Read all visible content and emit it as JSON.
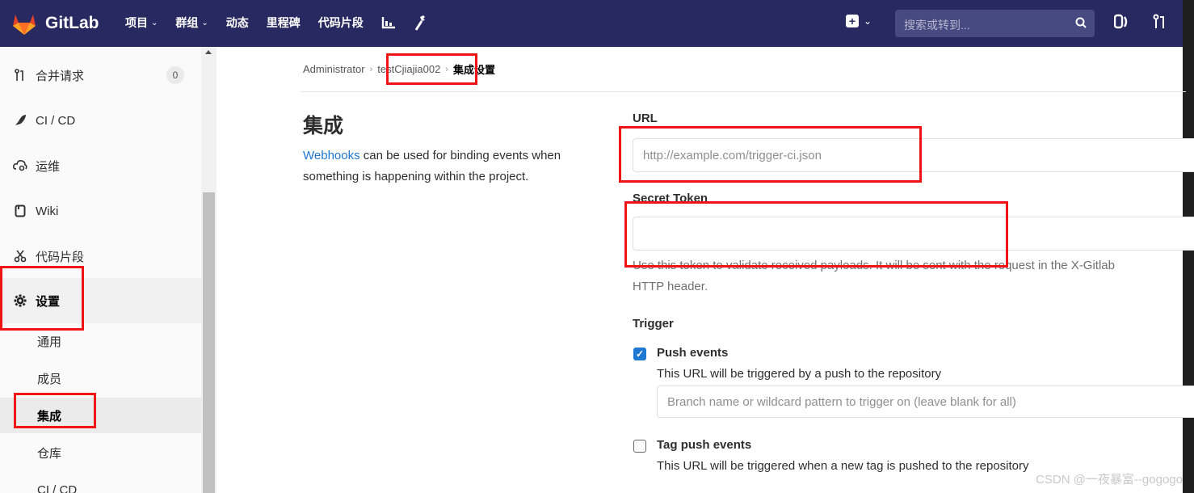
{
  "brand": {
    "name": "GitLab",
    "logo": "gitlab-fox-logo"
  },
  "topnav": {
    "items": [
      {
        "label": "项目",
        "dropdown": true
      },
      {
        "label": "群组",
        "dropdown": true
      },
      {
        "label": "动态",
        "dropdown": false
      },
      {
        "label": "里程碑",
        "dropdown": false
      },
      {
        "label": "代码片段",
        "dropdown": false
      }
    ],
    "chevron": "⌄",
    "search_placeholder": "搜索或转到...",
    "icons": [
      "chart-icon",
      "wrench-icon",
      "plus-square-icon",
      "search-icon",
      "issues-icon",
      "merge-request-icon"
    ]
  },
  "sidebar": {
    "items": [
      {
        "label": "合并请求",
        "icon": "merge-request-icon",
        "badge": "0"
      },
      {
        "label": "CI / CD",
        "icon": "rocket-icon"
      },
      {
        "label": "运维",
        "icon": "cloud-gear-icon"
      },
      {
        "label": "Wiki",
        "icon": "book-icon"
      },
      {
        "label": "代码片段",
        "icon": "scissors-icon"
      },
      {
        "label": "设置",
        "icon": "gear-icon",
        "active": true
      }
    ],
    "subitems": [
      {
        "label": "通用"
      },
      {
        "label": "成员"
      },
      {
        "label": "集成",
        "active": true
      },
      {
        "label": "仓库"
      },
      {
        "label": "CI / CD"
      }
    ]
  },
  "breadcrumb": {
    "items": [
      "Administrator",
      "testCjiajia002",
      "集成设置"
    ],
    "separator": "›"
  },
  "settings": {
    "title": "集成",
    "desc_link": "Webhooks",
    "desc_text": " can be used for binding events when something is happening within the project.",
    "url_label": "URL",
    "url_placeholder": "http://example.com/trigger-ci.json",
    "secret_label": "Secret Token",
    "secret_help_struck": "Use this token to validate received payloads. It will be sent",
    "secret_help_rest": " with the request in the X-Gitlab",
    "secret_help_line2": "HTTP header.",
    "trigger_label": "Trigger",
    "push_label": "Push events",
    "push_checked": true,
    "push_help": "This URL will be triggered by a push to the repository",
    "branch_placeholder": "Branch name or wildcard pattern to trigger on (leave blank for all)",
    "tag_label": "Tag push events",
    "tag_checked": false,
    "tag_help": "This URL will be triggered when a new tag is pushed to the repository"
  },
  "watermark": "CSDN @一夜暴富--gogogo",
  "colors": {
    "navbar": "#292961",
    "annotation": "#f01414",
    "link": "#1f78d1"
  }
}
